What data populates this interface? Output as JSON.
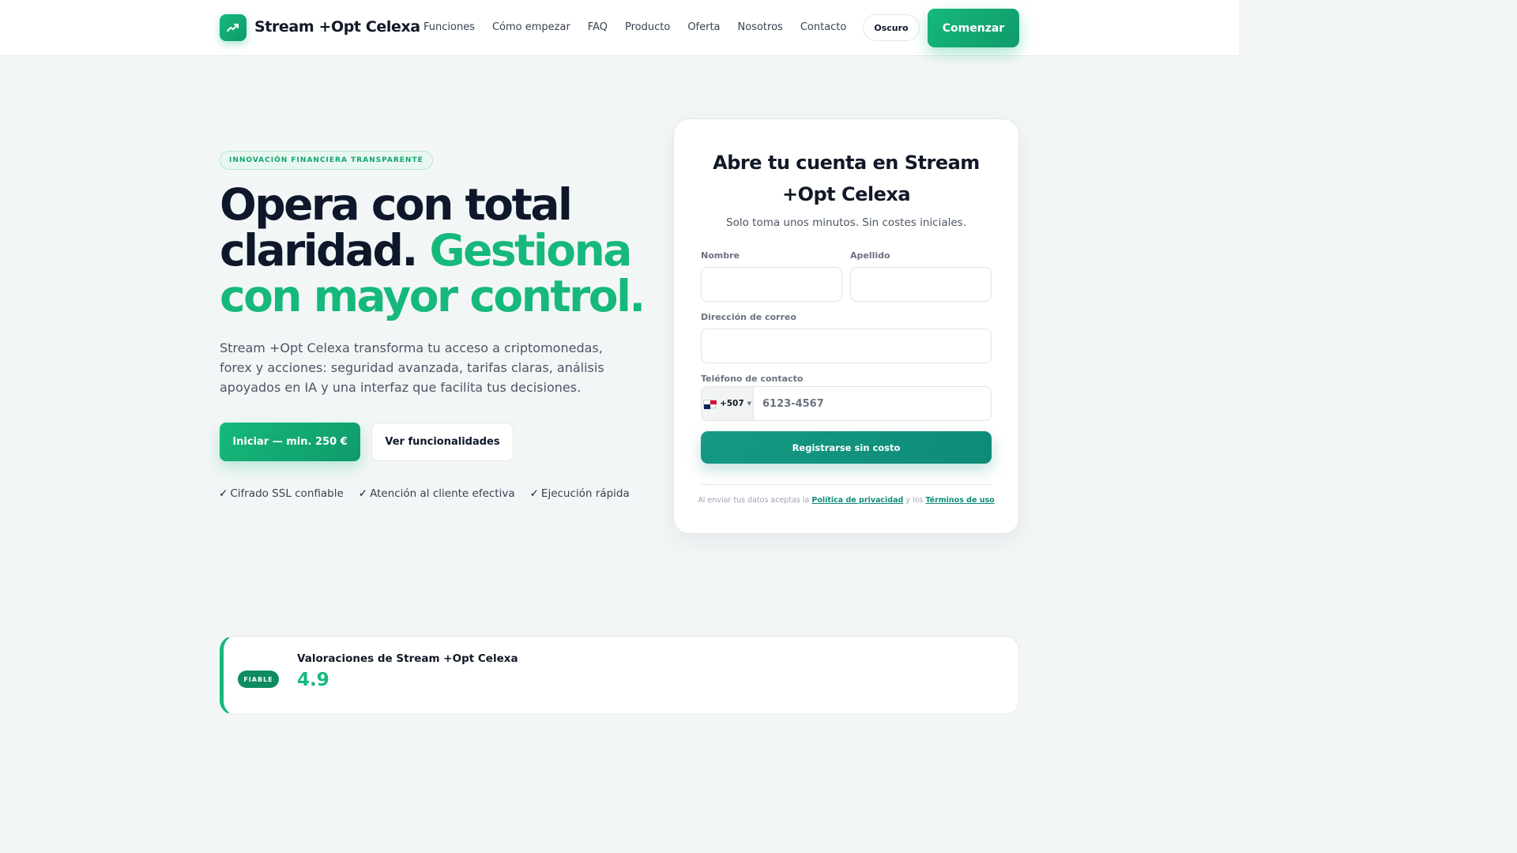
{
  "nav": {
    "brand": "Stream +Opt Celexa",
    "links": [
      "Funciones",
      "Cómo empezar",
      "FAQ",
      "Producto",
      "Oferta",
      "Nosotros",
      "Contacto"
    ],
    "theme_toggle": "Oscuro",
    "cta": "Comenzar"
  },
  "hero": {
    "badge": "INNOVACIÓN FINANCIERA TRANSPARENTE",
    "headline_line1": "Opera con total",
    "headline_dark2": "claridad.",
    "headline_green2": "Gestiona",
    "headline_green3": "con mayor control.",
    "lead": "Stream +Opt Celexa transforma tu acceso a criptomonedas, forex y acciones: seguridad avanzada, tarifas claras, análisis apoyados en IA y una interfaz que facilita tus decisiones.",
    "primary_button": "Iniciar — min. 250 €",
    "secondary_button": "Ver funcionalidades",
    "features": [
      "Cifrado SSL confiable",
      "Atención al cliente efectiva",
      "Ejecución rápida"
    ],
    "check_glyph": "✓"
  },
  "form": {
    "title": "Abre tu cuenta en Stream +Opt Celexa",
    "subtitle": "Solo toma unos minutos. Sin costes iniciales.",
    "first_name_label": "Nombre",
    "first_name_value": "",
    "last_name_label": "Apellido",
    "last_name_value": "",
    "email_label": "Dirección de correo",
    "email_value": "",
    "phone_label": "Teléfono de contacto",
    "phone_code": "+507",
    "phone_placeholder": "6123-4567",
    "submit": "Registrarse sin costo",
    "legal_prefix": "Al enviar tus datos aceptas la",
    "privacy_link": "Política de privacidad",
    "legal_mid": "y los",
    "terms_link": "Términos de uso"
  },
  "ratings": {
    "badge": "FIABLE",
    "title": "Valoraciones de Stream +Opt Celexa",
    "score": "4.9"
  },
  "colors": {
    "accent_green": "#16b97b",
    "teal_button": "#0e8b78",
    "text_dark": "#0f172a"
  }
}
